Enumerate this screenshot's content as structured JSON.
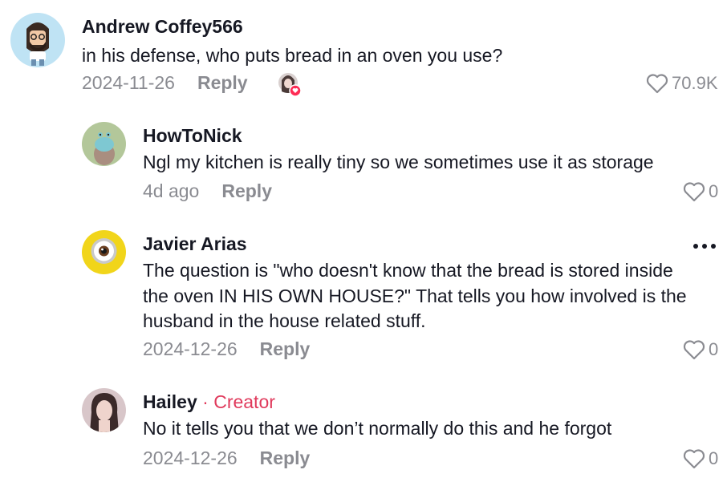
{
  "comments": [
    {
      "username": "Andrew Coffey566",
      "text": "in his defense, who puts bread in an oven you use?",
      "date": "2024-11-26",
      "reply_label": "Reply",
      "likes": "70.9K"
    },
    {
      "username": "HowToNick",
      "text": "Ngl my kitchen is really tiny so we sometimes use it as storage",
      "date": "4d ago",
      "reply_label": "Reply",
      "likes": "0"
    },
    {
      "username": "Javier Arias",
      "text": "The question is \"who doesn't know that the bread is stored inside the oven IN HIS OWN HOUSE?\" That tells you how involved is the husband in the house related stuff.",
      "date": "2024-12-26",
      "reply_label": "Reply",
      "likes": "0"
    },
    {
      "username": "Hailey",
      "creator_label": " · Creator",
      "text": "No it tells you that we don’t normally do this and he forgot",
      "date": "2024-12-26",
      "reply_label": "Reply",
      "likes": "0"
    }
  ],
  "colors": {
    "creator": "#e03a5c",
    "muted": "#8a8b91",
    "text": "#161823"
  }
}
